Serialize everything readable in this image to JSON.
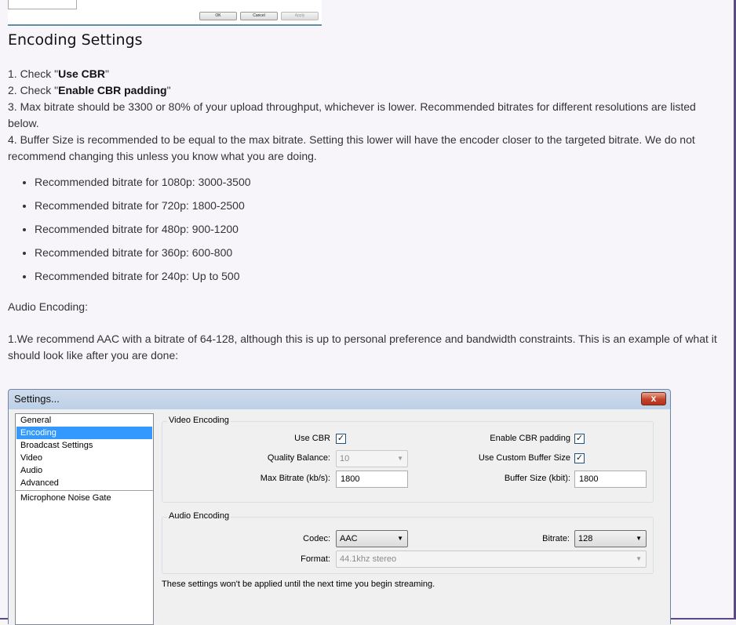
{
  "top_buttons": {
    "ok": "OK",
    "cancel": "Cancel",
    "apply": "Apply"
  },
  "heading": "Encoding Settings",
  "steps": {
    "s1_prefix": "1. Check \"",
    "s1_bold": "Use CBR",
    "s1_suffix": "\"",
    "s2_prefix": "2. Check \"",
    "s2_bold": "Enable CBR padding",
    "s2_suffix": "\"",
    "s3": "3. Max bitrate should be 3300 or 80% of your upload throughput, whichever is lower. Recommended bitrates for different resolutions are listed below.",
    "s4": "4. Buffer Size is recommended to be equal to the max bitrate. Setting this lower will have the encoder closer to the targeted bitrate. We do not recommend changing this unless you know what you are doing."
  },
  "bitrates": [
    "Recommended bitrate for 1080p: 3000-3500",
    "Recommended bitrate for 720p: 1800-2500",
    "Recommended bitrate for 480p: 900-1200",
    "Recommended bitrate for 360p: 600-800",
    "Recommended bitrate for 240p: Up to 500"
  ],
  "audio_title": "Audio Encoding:",
  "audio_text": "1.We recommend AAC with a bitrate of 64-128, although this is up to personal preference and bandwidth constraints. This is an example of what it should look like after you are done:",
  "dialog": {
    "title": "Settings...",
    "close": "x",
    "sidebar": [
      "General",
      "Encoding",
      "Broadcast Settings",
      "Video",
      "Audio",
      "Advanced",
      "Microphone Noise Gate"
    ],
    "video_group": "Video Encoding",
    "use_cbr": "Use CBR",
    "enable_cbr_padding": "Enable CBR padding",
    "quality_balance": "Quality Balance:",
    "quality_value": "10",
    "use_custom_buffer": "Use Custom Buffer Size",
    "max_bitrate": "Max Bitrate (kb/s):",
    "max_bitrate_value": "1800",
    "buffer_size": "Buffer Size (kbit):",
    "buffer_size_value": "1800",
    "audio_group": "Audio Encoding",
    "codec": "Codec:",
    "codec_value": "AAC",
    "bitrate": "Bitrate:",
    "bitrate_value": "128",
    "format": "Format:",
    "format_value": "44.1khz stereo",
    "note": "These settings won't be applied until the next time you begin streaming.",
    "check_mark": "✓"
  }
}
